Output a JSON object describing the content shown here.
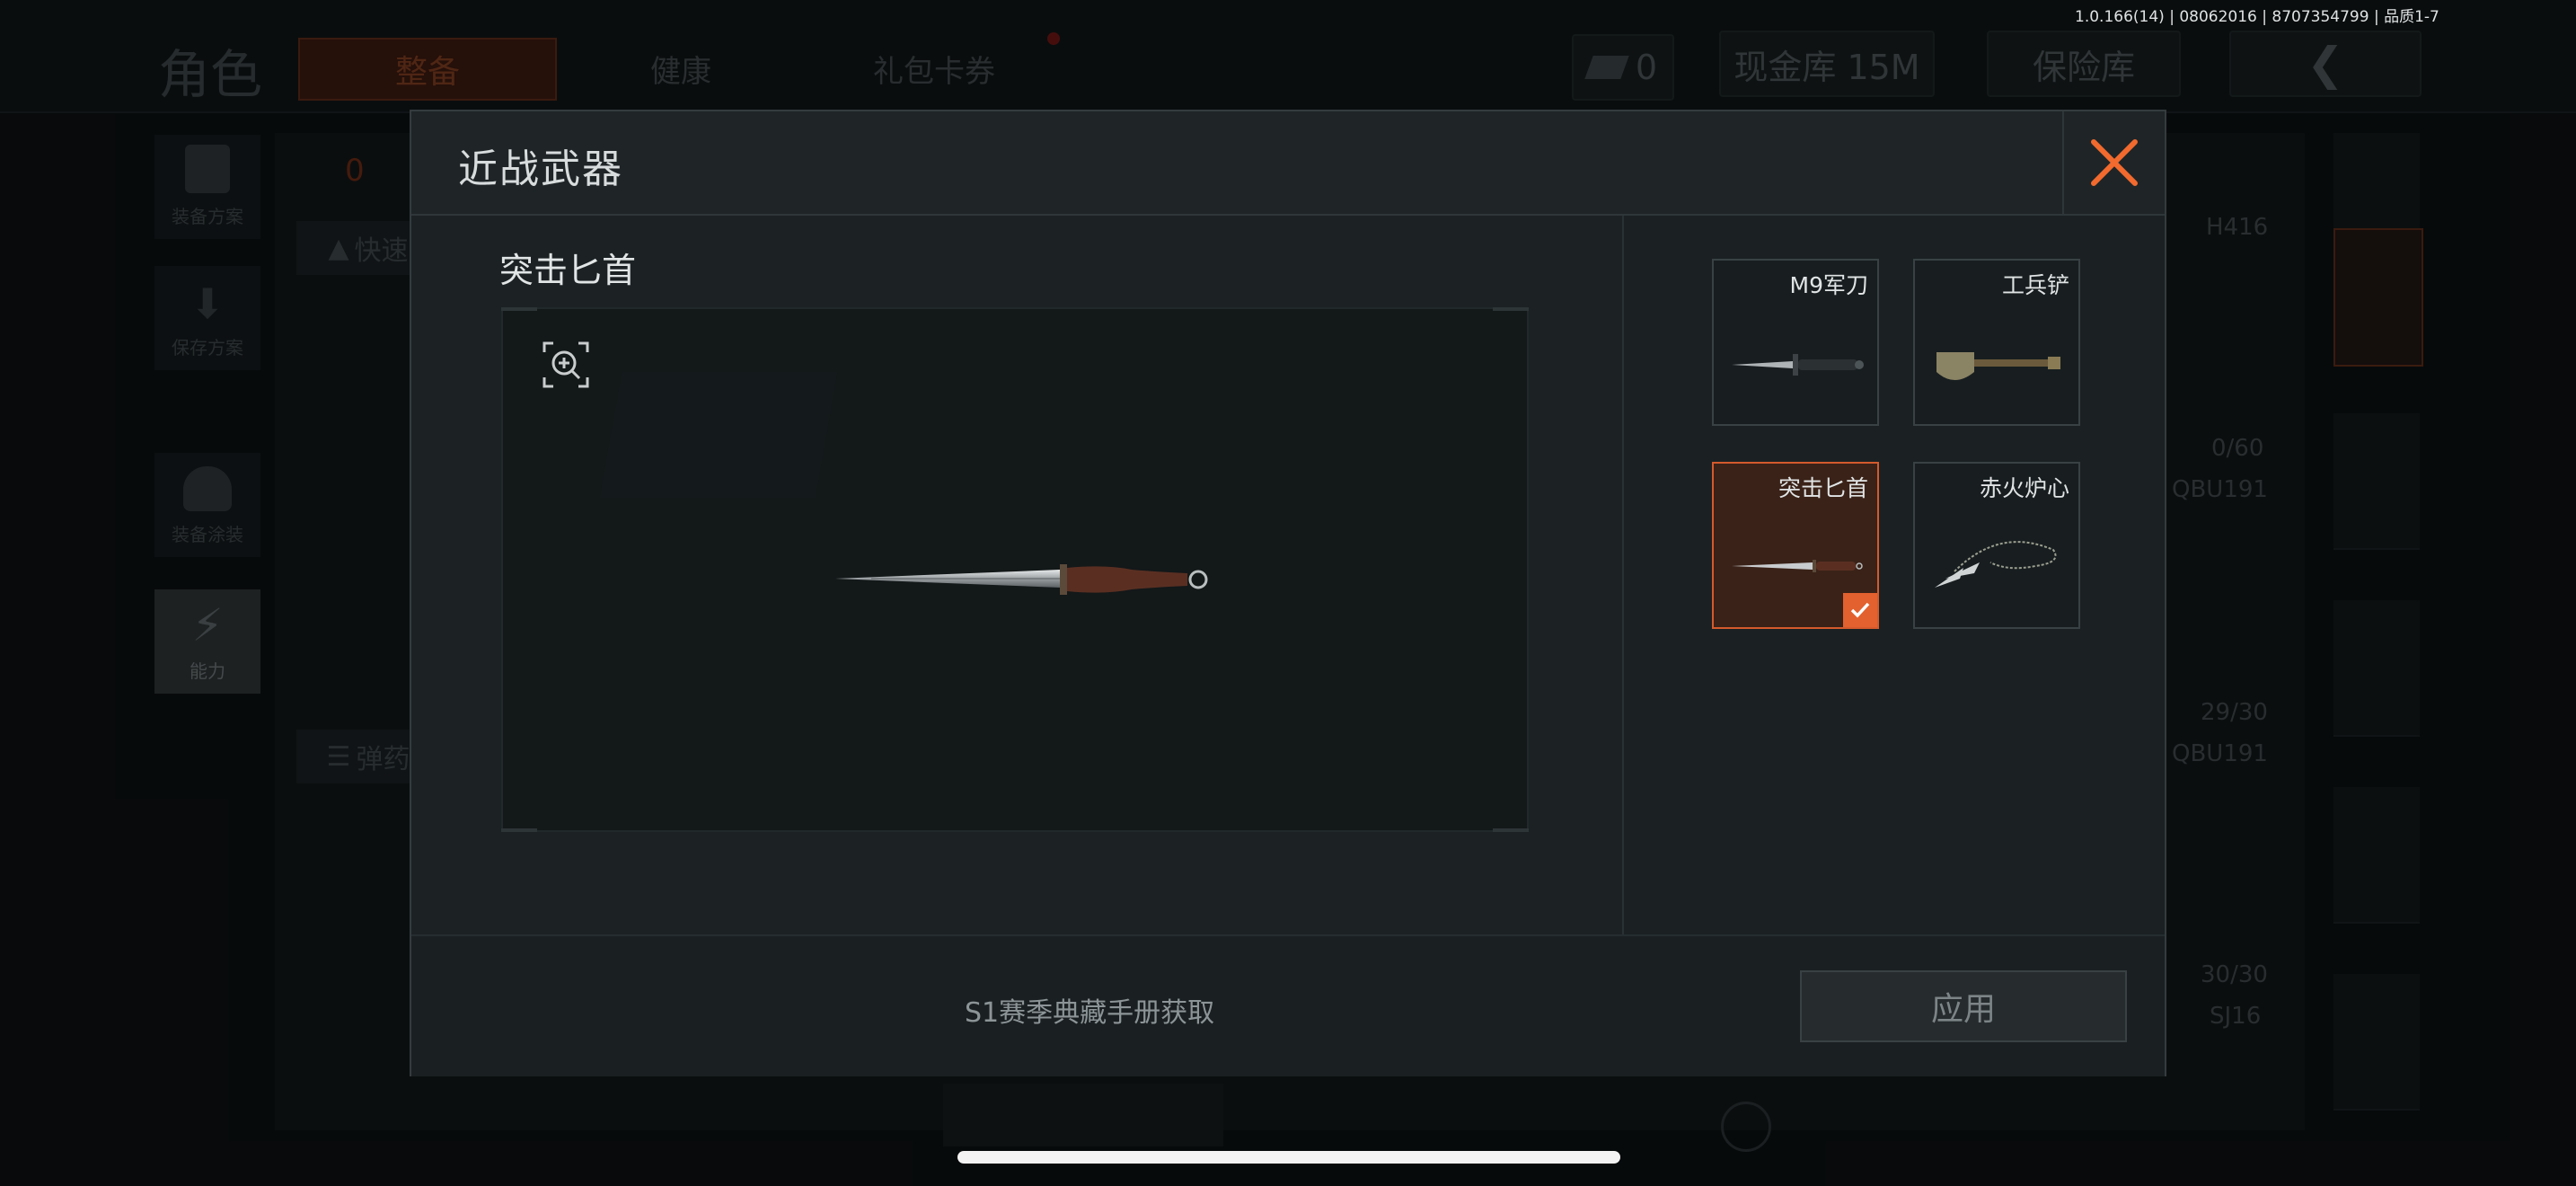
{
  "status": {
    "version": "1.0.166(14) | 08062016 | 8707354799 | 品质1-7"
  },
  "background": {
    "title": "角色",
    "tabs": [
      {
        "label": "整备",
        "active": true
      },
      {
        "label": "健康",
        "active": false
      },
      {
        "label": "礼包卡券",
        "active": false
      }
    ],
    "currency_count": "0",
    "vault_label": "现金库 15M",
    "insurance_label": "保险库",
    "side_buttons": [
      {
        "label": "装备方案",
        "icon": "vest-icon"
      },
      {
        "label": "保存方案",
        "icon": "download-icon"
      },
      {
        "label": "装备涂装",
        "icon": "helmet-icon"
      },
      {
        "label": "能力",
        "icon": "lightning-icon"
      }
    ],
    "quick_label": "快速",
    "ammo_label": "弹药",
    "count_badge": "0",
    "right_list": [
      {
        "name": "H416",
        "ammo": "0/60"
      },
      {
        "name": "QBU191",
        "ammo": "29/30"
      },
      {
        "name": "QBU191",
        "ammo": "30/30"
      },
      {
        "name": "SJ16",
        "ammo": ""
      }
    ]
  },
  "modal": {
    "title": "近战武器",
    "selected_item_name": "突击匕首",
    "acquire_text": "S1赛季典藏手册获取",
    "apply_label": "应用",
    "items": [
      {
        "name": "M9军刀",
        "icon": "bayonet-icon",
        "selected": false
      },
      {
        "name": "工兵铲",
        "icon": "shovel-icon",
        "selected": false
      },
      {
        "name": "突击匕首",
        "icon": "dagger-icon",
        "selected": true
      },
      {
        "name": "赤火炉心",
        "icon": "rope-dart-icon",
        "selected": false
      }
    ]
  },
  "colors": {
    "accent": "#e2612e",
    "close": "#f26a2e",
    "panel": "#1c2224"
  }
}
